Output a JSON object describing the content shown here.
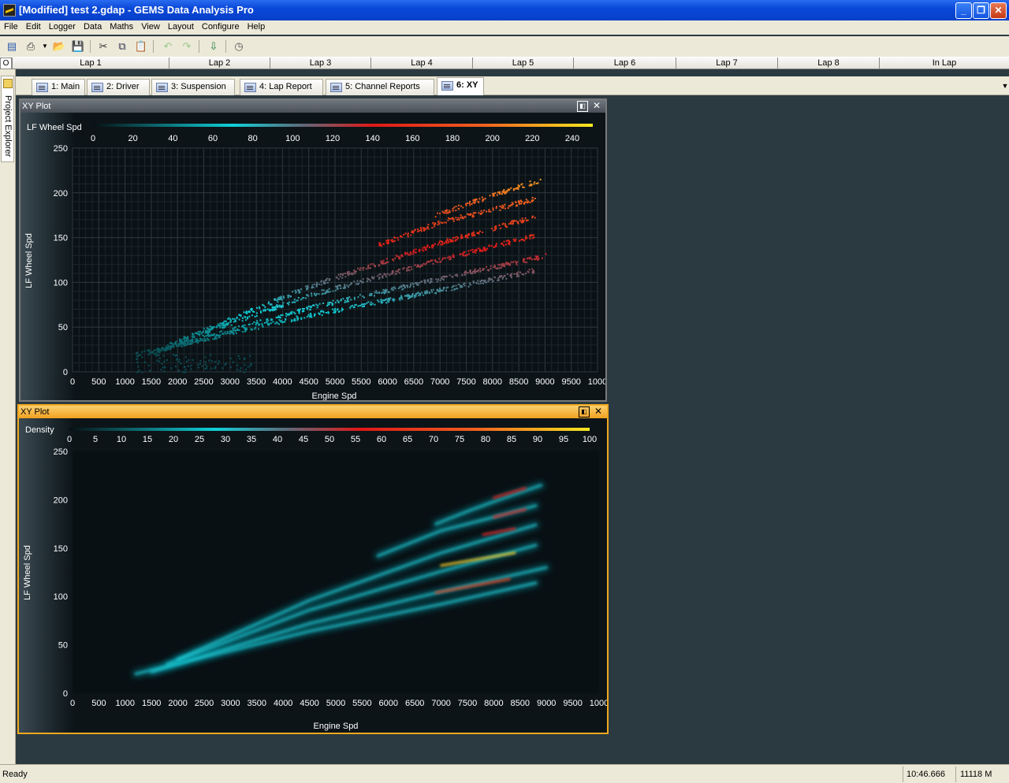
{
  "window": {
    "title": "[Modified] test 2.gdap - GEMS Data Analysis Pro",
    "minimize_icon": "minimize-icon",
    "maximize_icon": "restore-icon",
    "close_icon": "close-icon"
  },
  "menu": [
    "File",
    "Edit",
    "Logger",
    "Data",
    "Maths",
    "View",
    "Layout",
    "Configure",
    "Help"
  ],
  "toolbar": {
    "icons": [
      "new-icon",
      "print-icon",
      "open-icon",
      "save-icon",
      "cut-icon",
      "copy-icon",
      "paste-icon",
      "undo-icon",
      "redo-icon",
      "import-icon",
      "refresh-icon"
    ]
  },
  "laps": {
    "o_label": "O",
    "items": [
      "Lap 1",
      "Lap 2",
      "Lap 3",
      "Lap 4",
      "Lap 5",
      "Lap 6",
      "Lap 7",
      "Lap 8",
      "In Lap"
    ]
  },
  "sidebar": {
    "project_explorer": "Project Explorer"
  },
  "tabs": [
    {
      "label": "1: Main"
    },
    {
      "label": "2: Driver"
    },
    {
      "label": "3: Suspension"
    },
    {
      "label": "4: Lap Report"
    },
    {
      "label": "5: Channel Reports"
    },
    {
      "label": "6: XY"
    }
  ],
  "active_tab": 5,
  "colors": {
    "scatter_cyan": "#2ab0b8",
    "scatter_red": "#e02020",
    "scatter_yellow": "#f0c020",
    "active_panel": "#f0a820"
  },
  "chart_data": [
    {
      "type": "scatter",
      "title": "XY Plot",
      "xlabel": "Engine Spd",
      "ylabel": "LF Wheel Spd",
      "xlim": [
        0,
        10000
      ],
      "ylim": [
        0,
        250
      ],
      "x_ticks": [
        "0",
        "500",
        "1000",
        "1500",
        "2000",
        "2500",
        "3000",
        "3500",
        "4000",
        "4500",
        "5000",
        "5500",
        "6000",
        "6500",
        "7000",
        "7500",
        "8000",
        "8500",
        "9000",
        "9500",
        "1000"
      ],
      "y_ticks": [
        "0",
        "50",
        "100",
        "150",
        "200",
        "250"
      ],
      "grid": true,
      "colorbar": {
        "label": "LF Wheel Spd",
        "ticks": [
          "0",
          "20",
          "40",
          "60",
          "80",
          "100",
          "120",
          "140",
          "160",
          "180",
          "200",
          "220",
          "240"
        ]
      },
      "bands": [
        {
          "x": [
            1200,
            4500,
            7000,
            8800
          ],
          "y": [
            20,
            64,
            92,
            114
          ]
        },
        {
          "x": [
            1500,
            4500,
            7000,
            9000
          ],
          "y": [
            22,
            72,
            105,
            130
          ]
        },
        {
          "x": [
            1800,
            4500,
            7000,
            8800
          ],
          "y": [
            30,
            86,
            126,
            153
          ]
        },
        {
          "x": [
            2000,
            4500,
            7000,
            8800
          ],
          "y": [
            35,
            96,
            145,
            174
          ]
        },
        {
          "x": [
            5800,
            7000,
            8000,
            8800
          ],
          "y": [
            142,
            168,
            182,
            194
          ]
        },
        {
          "x": [
            6900,
            7500,
            8200,
            8900
          ],
          "y": [
            175,
            188,
            202,
            215
          ]
        }
      ]
    },
    {
      "type": "heatmap",
      "title": "XY Plot",
      "xlabel": "Engine Spd",
      "ylabel": "LF Wheel Spd",
      "xlim": [
        0,
        10000
      ],
      "ylim": [
        0,
        250
      ],
      "x_ticks": [
        "0",
        "500",
        "1000",
        "1500",
        "2000",
        "2500",
        "3000",
        "3500",
        "4000",
        "4500",
        "5000",
        "5500",
        "6000",
        "6500",
        "7000",
        "7500",
        "8000",
        "8500",
        "9000",
        "9500",
        "1000"
      ],
      "y_ticks": [
        "0",
        "50",
        "100",
        "150",
        "200",
        "250"
      ],
      "colorbar": {
        "label": "Density",
        "ticks": [
          "0",
          "5",
          "10",
          "15",
          "20",
          "25",
          "30",
          "35",
          "40",
          "45",
          "50",
          "55",
          "60",
          "65",
          "70",
          "75",
          "80",
          "85",
          "90",
          "95",
          "100"
        ]
      }
    }
  ],
  "status": {
    "left": "Ready",
    "time": "10:46.666",
    "memory": "11118 M"
  }
}
